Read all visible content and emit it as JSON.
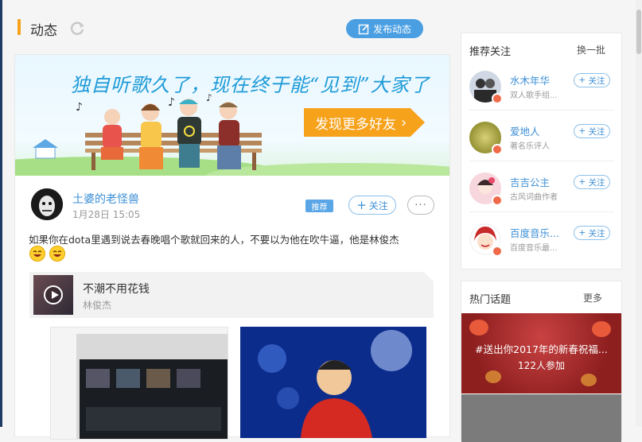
{
  "header": {
    "title": "动态",
    "publish_label": "发布动态"
  },
  "banner": {
    "text": "独自听歌久了，现在终于能“见到”大家了",
    "button_label": "发现更多好友"
  },
  "post": {
    "author": "土婆的老怪兽",
    "time": "1月28日 15:05",
    "tag": "推荐",
    "follow_label": "关注",
    "more_label": "···",
    "text": "如果你在dota里遇到说去春晚唱个歌就回来的人，不要以为他在吹牛逼，他是林俊杰",
    "song": {
      "title": "不潮不用花钱",
      "artist": "林俊杰"
    }
  },
  "recommend": {
    "title": "推荐关注",
    "refresh_label": "换一批",
    "follow_label": "关注",
    "items": [
      {
        "name": "水木年华",
        "desc": "双人歌手组..."
      },
      {
        "name": "爱地人",
        "desc": "著名乐评人"
      },
      {
        "name": "吉吉公主",
        "desc": "古风词曲作者"
      },
      {
        "name": "百度音乐...",
        "desc": "百度音乐最..."
      }
    ]
  },
  "hot": {
    "title": "热门话题",
    "more_label": "更多",
    "topic": "#送出你2017年的新春祝福...",
    "count": "122人参加"
  },
  "colors": {
    "accent": "#4a9fe3",
    "orange": "#f7a21b",
    "link": "#3c8fd6"
  }
}
